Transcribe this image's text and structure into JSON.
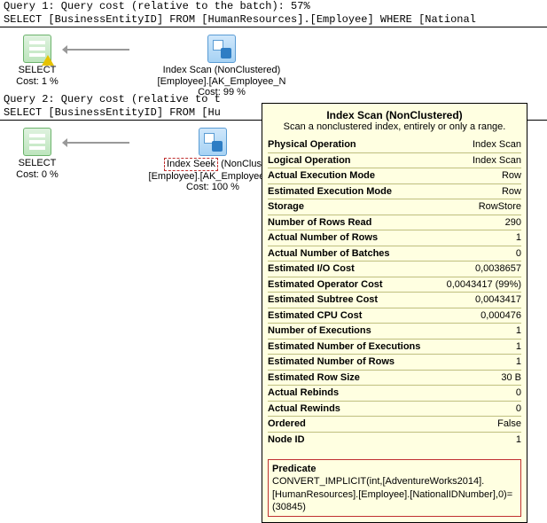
{
  "query1": {
    "header": "Query 1: Query cost (relative to the batch): 57%",
    "sql": "SELECT [BusinessEntityID] FROM [HumanResources].[Employee] WHERE [National",
    "select": {
      "label": "SELECT",
      "cost": "Cost: 1 %"
    },
    "op": {
      "title": "Index Scan (NonClustered)",
      "obj": "[Employee].[AK_Employee_N",
      "cost": "Cost: 99 %"
    }
  },
  "query2": {
    "header": "Query 2: Query cost (relative to t",
    "sql": "SELECT [BusinessEntityID] FROM [Hu",
    "select": {
      "label": "SELECT",
      "cost": "Cost: 0 %"
    },
    "op": {
      "seek": "Index Seek",
      "rest": " (NonClus",
      "obj": "[Employee].[AK_Employee_N",
      "cost": "Cost: 100 %"
    }
  },
  "tooltip": {
    "title": "Index Scan (NonClustered)",
    "sub": "Scan a nonclustered index, entirely or only a range.",
    "rows": [
      {
        "k": "Physical Operation",
        "v": "Index Scan"
      },
      {
        "k": "Logical Operation",
        "v": "Index Scan"
      },
      {
        "k": "Actual Execution Mode",
        "v": "Row"
      },
      {
        "k": "Estimated Execution Mode",
        "v": "Row"
      },
      {
        "k": "Storage",
        "v": "RowStore"
      },
      {
        "k": "Number of Rows Read",
        "v": "290"
      },
      {
        "k": "Actual Number of Rows",
        "v": "1"
      },
      {
        "k": "Actual Number of Batches",
        "v": "0"
      },
      {
        "k": "Estimated I/O Cost",
        "v": "0,0038657"
      },
      {
        "k": "Estimated Operator Cost",
        "v": "0,0043417 (99%)"
      },
      {
        "k": "Estimated Subtree Cost",
        "v": "0,0043417"
      },
      {
        "k": "Estimated CPU Cost",
        "v": "0,000476"
      },
      {
        "k": "Number of Executions",
        "v": "1"
      },
      {
        "k": "Estimated Number of Executions",
        "v": "1"
      },
      {
        "k": "Estimated Number of Rows",
        "v": "1"
      },
      {
        "k": "Estimated Row Size",
        "v": "30 B"
      },
      {
        "k": "Actual Rebinds",
        "v": "0"
      },
      {
        "k": "Actual Rewinds",
        "v": "0"
      },
      {
        "k": "Ordered",
        "v": "False"
      },
      {
        "k": "Node ID",
        "v": "1"
      }
    ],
    "predicate": {
      "label": "Predicate",
      "text": "CONVERT_IMPLICIT(int,[AdventureWorks2014].[HumanResources].[Employee].[NationalIDNumber],0)=(30845)"
    }
  }
}
